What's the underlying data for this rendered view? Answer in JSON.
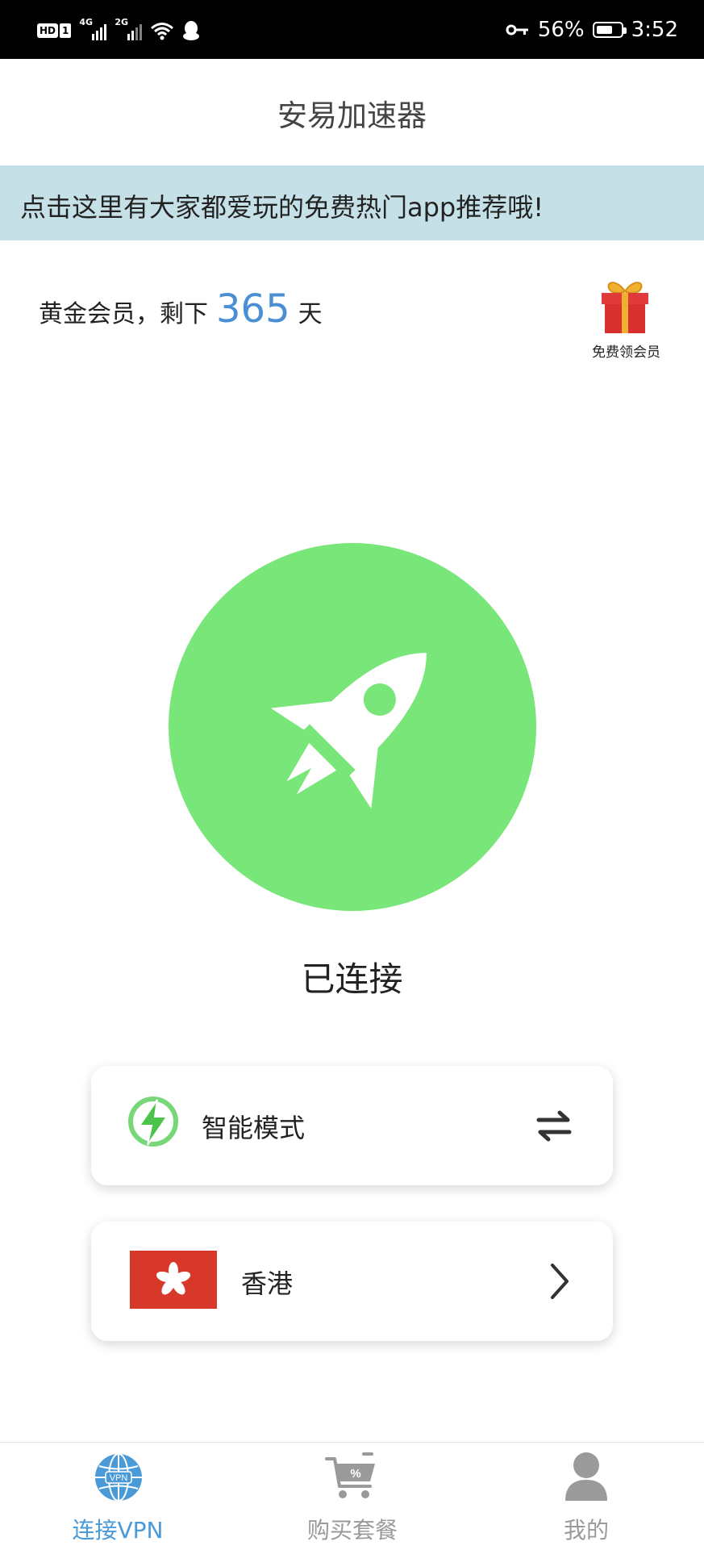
{
  "status_bar": {
    "hd": "HD",
    "sim": "1",
    "network_1": "4G",
    "network_2": "2G",
    "battery": "56%",
    "time": "3:52"
  },
  "header": {
    "title": "安易加速器"
  },
  "banner": {
    "text": "点击这里有大家都爱玩的免费热门app推荐哦!"
  },
  "membership": {
    "prefix": "黄金会员，剩下",
    "days": "365",
    "suffix": "天",
    "gift_label": "免费领会员"
  },
  "connection": {
    "status": "已连接",
    "button_color": "#78e678",
    "icon": "rocket-icon"
  },
  "mode_card": {
    "icon": "lightning-icon",
    "label": "智能模式",
    "action_icon": "swap-arrows-icon"
  },
  "region_card": {
    "icon": "hong-kong-flag",
    "label": "香港",
    "action_icon": "chevron-right-icon"
  },
  "bottom_nav": {
    "items": [
      {
        "label": "连接VPN",
        "icon": "vpn-globe-icon",
        "active": true,
        "color": "#4a9ad8"
      },
      {
        "label": "购买套餐",
        "icon": "shopping-cart-icon",
        "active": false,
        "color": "#9a9a9a"
      },
      {
        "label": "我的",
        "icon": "user-icon",
        "active": false,
        "color": "#9a9a9a"
      }
    ]
  },
  "colors": {
    "accent": "#4a8fd4",
    "banner_bg": "#c5e1e7",
    "connected_green": "#78e678"
  }
}
